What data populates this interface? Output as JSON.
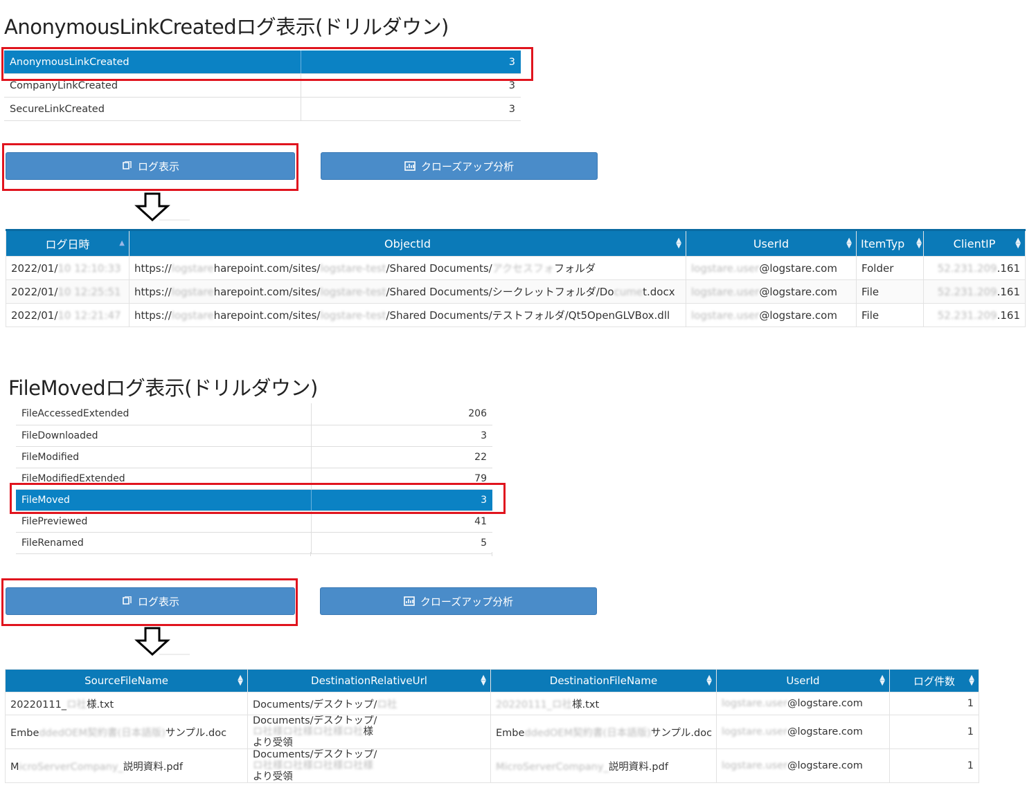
{
  "section1": {
    "title": "AnonymousLinkCreatedログ表示(ドリルダウン)",
    "summary_rows": [
      {
        "name": "AnonymousLinkCreated",
        "count": "3"
      },
      {
        "name": "CompanyLinkCreated",
        "count": "3"
      },
      {
        "name": "SecureLinkCreated",
        "count": "3"
      }
    ],
    "log_button": "ログ表示",
    "closeup_button": "クローズアップ分析",
    "table": {
      "headers": [
        "ログ日時",
        "ObjectId",
        "UserId",
        "ItemTyp",
        "ClientIP"
      ],
      "rows": [
        {
          "date": "2022/01/",
          "date_mask": "10 12:10:33",
          "obj_a": "https://",
          "obj_mask1": "logstare",
          "obj_b": "harepoint.com/sites/",
          "obj_mask2": "logstare-test",
          "obj_c": "/Shared Documents/",
          "obj_mask3": "アクセスフォ",
          "obj_d": "フォルダ",
          "user_mask": "logstare.user",
          "user": "@logstare.com",
          "type": "Folder",
          "ip_mask": "52.231.209",
          "ip": ".161"
        },
        {
          "date": "2022/01/",
          "date_mask": "10 12:25:51",
          "obj_a": "https://",
          "obj_mask1": "logstare",
          "obj_b": "harepoint.com/sites/",
          "obj_mask2": "logstare-test",
          "obj_c": "/Shared Documents/シークレットフォルダ/Do",
          "obj_mask3": "cume",
          "obj_d": "t.docx",
          "user_mask": "logstare.user",
          "user": "@logstare.com",
          "type": "File",
          "ip_mask": "52.231.209",
          "ip": ".161"
        },
        {
          "date": "2022/01/",
          "date_mask": "10 12:21:47",
          "obj_a": "https://",
          "obj_mask1": "logstare",
          "obj_b": "harepoint.com/sites/",
          "obj_mask2": "logstare-test",
          "obj_c": "/Shared Documents/テストフォルダ/Qt5OpenGLVBox.dll",
          "obj_mask3": "",
          "obj_d": "",
          "user_mask": "logstare.user",
          "user": "@logstare.com",
          "type": "File",
          "ip_mask": "52.231.209",
          "ip": ".161"
        }
      ]
    }
  },
  "section2": {
    "title": "FileMovedログ表示(ドリルダウン)",
    "summary_rows": [
      {
        "name": "FileAccessedExtended",
        "count": "206"
      },
      {
        "name": "FileDownloaded",
        "count": "3"
      },
      {
        "name": "FileModified",
        "count": "22"
      },
      {
        "name": "FileModifiedExtended",
        "count": "79"
      },
      {
        "name": "FileMoved",
        "count": "3"
      },
      {
        "name": "FilePreviewed",
        "count": "41"
      },
      {
        "name": "FileRenamed",
        "count": "5"
      }
    ],
    "log_button": "ログ表示",
    "closeup_button": "クローズアップ分析",
    "table": {
      "headers": [
        "SourceFileName",
        "DestinationRelativeUrl",
        "DestinationFileName",
        "UserId",
        "ログ件数"
      ],
      "rows": [
        {
          "src_a": "20220111_",
          "src_mask": "ロ社",
          "src_b": "様.txt",
          "dst_a": "Documents/デスクトップ/",
          "dst_mask": "ロ社",
          "dst_b": "",
          "dst_line2": "",
          "dfn_mask": "20220111_ロ社",
          "dfn_a": "",
          "dfn_b": "様.txt",
          "user_mask": "logstare.user",
          "user": "@logstare.com",
          "count": "1"
        },
        {
          "src_a": "Embe",
          "src_mask": "ddedOEM契約書(日本語版)",
          "src_b": "サンプル.doc",
          "dst_a": "Documents/デスクトップ/",
          "dst_mask": "ロ社様ロ社様ロ社様ロ社",
          "dst_b": "様",
          "dst_line2": "より受領",
          "dfn_mask": "ddedOEM契約書(日本語版)",
          "dfn_a": "Embe",
          "dfn_b": "サンプル.doc",
          "user_mask": "logstare.user",
          "user": "@logstare.com",
          "count": "1"
        },
        {
          "src_a": "M",
          "src_mask": "icroServerCompany_",
          "src_b": "説明資料.pdf",
          "dst_a": "Documents/デスクトップ/",
          "dst_mask": "ロ社様ロ社様ロ社様ロ社様",
          "dst_b": "",
          "dst_line2": "より受領",
          "dfn_mask": "MicroServerCompany_",
          "dfn_a": "",
          "dfn_b": "説明資料.pdf",
          "user_mask": "logstare.user",
          "user": "@logstare.com",
          "count": "1"
        }
      ]
    }
  },
  "colors": {
    "selected_row": "#0b82c4",
    "header_bg": "#0b7ab8",
    "button_bg": "#4a8cc9",
    "highlight_border": "#e0141e"
  },
  "icons": {
    "log_button_icon": "book-icon",
    "closeup_button_icon": "chart-icon",
    "arrow": "down-arrow-icon"
  }
}
